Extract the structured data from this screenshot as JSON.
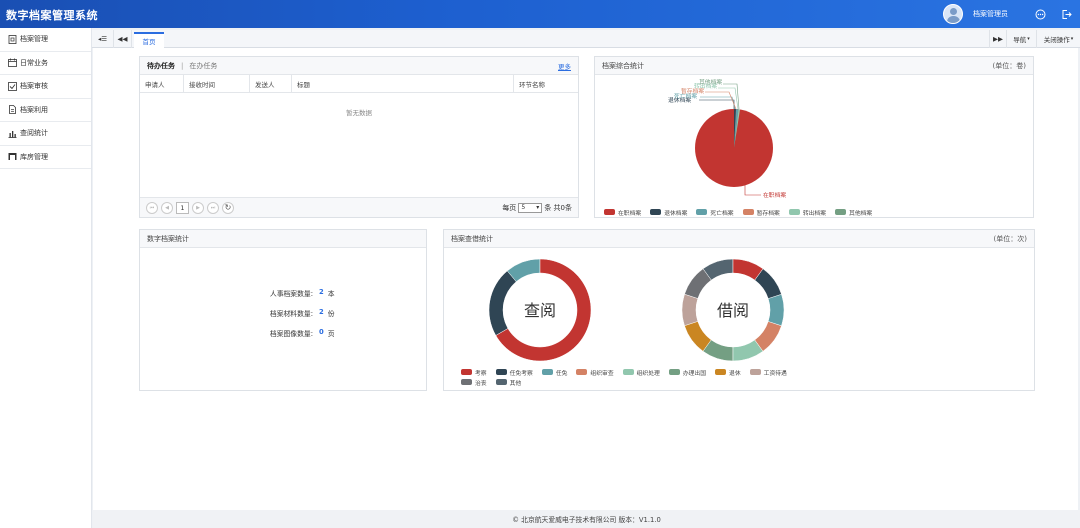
{
  "app": {
    "title": "数字档案管理系统"
  },
  "header": {
    "user_name": "档案管理员"
  },
  "sidebar": {
    "items": [
      {
        "label": "档案管理",
        "icon": "archive-icon"
      },
      {
        "label": "日常业务",
        "icon": "calendar-icon"
      },
      {
        "label": "档案审核",
        "icon": "check-icon"
      },
      {
        "label": "档案利用",
        "icon": "document-icon"
      },
      {
        "label": "查阅统计",
        "icon": "bar-chart-icon"
      },
      {
        "label": "库房管理",
        "icon": "warehouse-icon"
      }
    ]
  },
  "tabbar": {
    "home_tab": "首页",
    "nav_label": "导航",
    "close_ops_label": "关闭操作"
  },
  "tasks": {
    "tab_pending": "待办任务",
    "tab_in_progress": "在办任务",
    "more": "更多",
    "columns": [
      "申请人",
      "接收时间",
      "发送人",
      "标题",
      "环节名称"
    ],
    "empty_text": "暂无数据",
    "pager": {
      "page": "1",
      "per_page_label": "每页",
      "per_page": "5",
      "total_text": "条 共0条"
    }
  },
  "archive_stats": {
    "title": "档案综合统计",
    "unit": "(单位：卷)",
    "slice_labels": [
      "在职档案",
      "退休档案",
      "死亡档案",
      "暂存档案",
      "转出档案",
      "其他档案"
    ],
    "legend": [
      {
        "label": "在职档案",
        "color": "#c23531"
      },
      {
        "label": "退休档案",
        "color": "#2f4554"
      },
      {
        "label": "死亡档案",
        "color": "#61a0a8"
      },
      {
        "label": "暂存档案",
        "color": "#d48265"
      },
      {
        "label": "转出档案",
        "color": "#91c7ae"
      },
      {
        "label": "其他档案",
        "color": "#749f83"
      }
    ]
  },
  "digital_stats": {
    "title": "数字档案统计",
    "rows": [
      {
        "label": "人事档案数量:",
        "value": "2",
        "unit": "本"
      },
      {
        "label": "档案材料数量:",
        "value": "2",
        "unit": "份"
      },
      {
        "label": "档案图像数量:",
        "value": "0",
        "unit": "页"
      }
    ]
  },
  "lookup_stats": {
    "title": "档案查借统计",
    "unit": "(单位：次)",
    "donut_left_label": "查阅",
    "donut_right_label": "借阅",
    "legend": [
      {
        "label": "考察",
        "color": "#c23531"
      },
      {
        "label": "任免考察",
        "color": "#2f4554"
      },
      {
        "label": "任免",
        "color": "#61a0a8"
      },
      {
        "label": "组织审查",
        "color": "#d48265"
      },
      {
        "label": "组织处理",
        "color": "#91c7ae"
      },
      {
        "label": "办理出国",
        "color": "#749f83"
      },
      {
        "label": "退休",
        "color": "#ca8622"
      },
      {
        "label": "工资待遇",
        "color": "#bda29a"
      },
      {
        "label": "治丧",
        "color": "#6e7074"
      },
      {
        "label": "其他",
        "color": "#546570"
      }
    ]
  },
  "footer": {
    "text": "© 北京航天爱威电子技术有限公司 版本：V1.1.0"
  }
}
